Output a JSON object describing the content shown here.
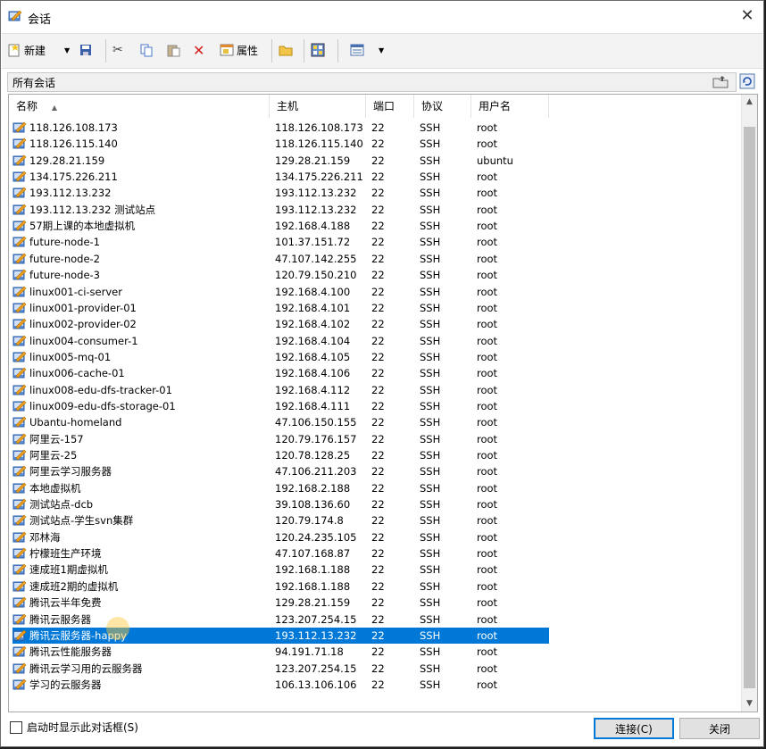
{
  "window": {
    "title": "会话"
  },
  "toolbar": {
    "new_label": "新建",
    "properties_label": "属性"
  },
  "address": {
    "path": "所有会话"
  },
  "columns": {
    "name": "名称",
    "host": "主机",
    "port": "端口",
    "protocol": "协议",
    "user": "用户名"
  },
  "sessions": [
    {
      "name": "118.126.108.173",
      "host": "118.126.108.173",
      "port": "22",
      "protocol": "SSH",
      "user": "root"
    },
    {
      "name": "118.126.115.140",
      "host": "118.126.115.140",
      "port": "22",
      "protocol": "SSH",
      "user": "root"
    },
    {
      "name": "129.28.21.159",
      "host": "129.28.21.159",
      "port": "22",
      "protocol": "SSH",
      "user": "ubuntu"
    },
    {
      "name": "134.175.226.211",
      "host": "134.175.226.211",
      "port": "22",
      "protocol": "SSH",
      "user": "root"
    },
    {
      "name": "193.112.13.232",
      "host": "193.112.13.232",
      "port": "22",
      "protocol": "SSH",
      "user": "root"
    },
    {
      "name": "193.112.13.232 测试站点",
      "host": "193.112.13.232",
      "port": "22",
      "protocol": "SSH",
      "user": "root"
    },
    {
      "name": "57期上课的本地虚拟机",
      "host": "192.168.4.188",
      "port": "22",
      "protocol": "SSH",
      "user": "root"
    },
    {
      "name": "future-node-1",
      "host": "101.37.151.72",
      "port": "22",
      "protocol": "SSH",
      "user": "root"
    },
    {
      "name": "future-node-2",
      "host": "47.107.142.255",
      "port": "22",
      "protocol": "SSH",
      "user": "root"
    },
    {
      "name": "future-node-3",
      "host": "120.79.150.210",
      "port": "22",
      "protocol": "SSH",
      "user": "root"
    },
    {
      "name": "linux001-ci-server",
      "host": "192.168.4.100",
      "port": "22",
      "protocol": "SSH",
      "user": "root"
    },
    {
      "name": "linux001-provider-01",
      "host": "192.168.4.101",
      "port": "22",
      "protocol": "SSH",
      "user": "root"
    },
    {
      "name": "linux002-provider-02",
      "host": "192.168.4.102",
      "port": "22",
      "protocol": "SSH",
      "user": "root"
    },
    {
      "name": "linux004-consumer-1",
      "host": "192.168.4.104",
      "port": "22",
      "protocol": "SSH",
      "user": "root"
    },
    {
      "name": "linux005-mq-01",
      "host": "192.168.4.105",
      "port": "22",
      "protocol": "SSH",
      "user": "root"
    },
    {
      "name": "linux006-cache-01",
      "host": "192.168.4.106",
      "port": "22",
      "protocol": "SSH",
      "user": "root"
    },
    {
      "name": "linux008-edu-dfs-tracker-01",
      "host": "192.168.4.112",
      "port": "22",
      "protocol": "SSH",
      "user": "root"
    },
    {
      "name": "linux009-edu-dfs-storage-01",
      "host": "192.168.4.111",
      "port": "22",
      "protocol": "SSH",
      "user": "root"
    },
    {
      "name": "Ubantu-homeland",
      "host": "47.106.150.155",
      "port": "22",
      "protocol": "SSH",
      "user": "root"
    },
    {
      "name": "阿里云-157",
      "host": "120.79.176.157",
      "port": "22",
      "protocol": "SSH",
      "user": "root"
    },
    {
      "name": "阿里云-25",
      "host": "120.78.128.25",
      "port": "22",
      "protocol": "SSH",
      "user": "root"
    },
    {
      "name": "阿里云学习服务器",
      "host": "47.106.211.203",
      "port": "22",
      "protocol": "SSH",
      "user": "root"
    },
    {
      "name": "本地虚拟机",
      "host": "192.168.2.188",
      "port": "22",
      "protocol": "SSH",
      "user": "root"
    },
    {
      "name": "测试站点-dcb",
      "host": "39.108.136.60",
      "port": "22",
      "protocol": "SSH",
      "user": "root"
    },
    {
      "name": "测试站点-学生svn集群",
      "host": "120.79.174.8",
      "port": "22",
      "protocol": "SSH",
      "user": "root"
    },
    {
      "name": "邓林海",
      "host": "120.24.235.105",
      "port": "22",
      "protocol": "SSH",
      "user": "root"
    },
    {
      "name": "柠檬班生产环境",
      "host": "47.107.168.87",
      "port": "22",
      "protocol": "SSH",
      "user": "root"
    },
    {
      "name": "速成班1期虚拟机",
      "host": "192.168.1.188",
      "port": "22",
      "protocol": "SSH",
      "user": "root"
    },
    {
      "name": "速成班2期的虚拟机",
      "host": "192.168.1.188",
      "port": "22",
      "protocol": "SSH",
      "user": "root"
    },
    {
      "name": "腾讯云半年免费",
      "host": "129.28.21.159",
      "port": "22",
      "protocol": "SSH",
      "user": "root"
    },
    {
      "name": "腾讯云服务器",
      "host": "123.207.254.15",
      "port": "22",
      "protocol": "SSH",
      "user": "root"
    },
    {
      "name": "腾讯云服务器-happy",
      "host": "193.112.13.232",
      "port": "22",
      "protocol": "SSH",
      "user": "root",
      "selected": true
    },
    {
      "name": "腾讯云性能服务器",
      "host": "94.191.71.18",
      "port": "22",
      "protocol": "SSH",
      "user": "root"
    },
    {
      "name": "腾讯云学习用的云服务器",
      "host": "123.207.254.15",
      "port": "22",
      "protocol": "SSH",
      "user": "root"
    },
    {
      "name": "学习的云服务器",
      "host": "106.13.106.106",
      "port": "22",
      "protocol": "SSH",
      "user": "root"
    }
  ],
  "footer": {
    "startup_checkbox_label": "启动时显示此对话框(S)",
    "connect_label": "连接(C)",
    "close_label": "关闭"
  },
  "colors": {
    "selection": "#0078d7",
    "icon_blue": "#3a7bd5",
    "icon_orange": "#f0a020"
  }
}
